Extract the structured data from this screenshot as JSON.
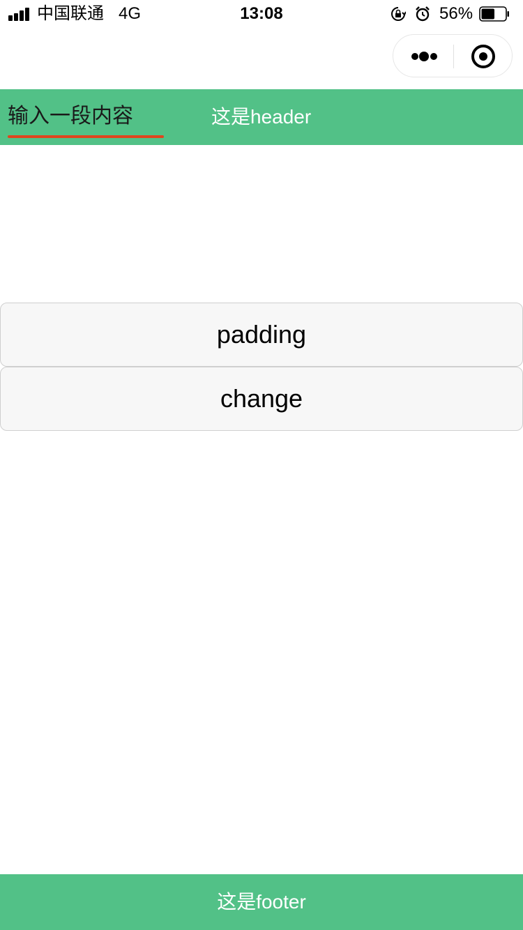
{
  "status_bar": {
    "carrier": "中国联通",
    "network": "4G",
    "time": "13:08",
    "battery_percent": "56%",
    "battery_level": 0.56,
    "icons": [
      "signal-icon",
      "orientation-lock-icon",
      "alarm-icon",
      "battery-icon"
    ]
  },
  "capsule": {
    "icons": [
      "more-dots-icon",
      "close-target-icon"
    ]
  },
  "header": {
    "input_placeholder": "输入一段内容",
    "title": "这是header",
    "background": "#52c187",
    "underline_color": "#e0461e"
  },
  "buttons": {
    "padding_label": "padding",
    "change_label": "change"
  },
  "footer": {
    "text": "这是footer",
    "background": "#52c187"
  }
}
